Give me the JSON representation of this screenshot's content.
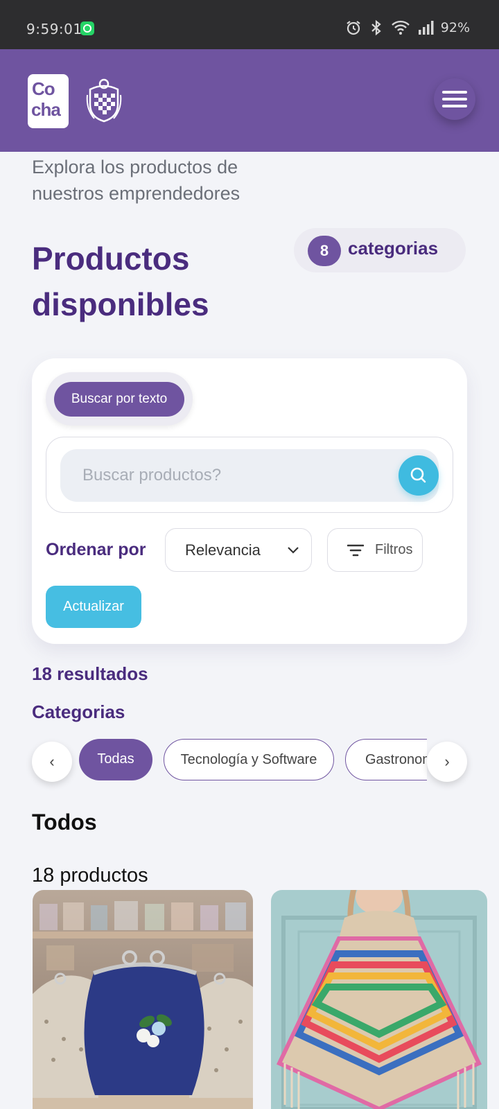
{
  "status_bar": {
    "time": "9:59:01",
    "battery": "92%"
  },
  "header": {
    "logo_line1": "Co",
    "logo_line2": "cha",
    "icons": [
      "whatsapp-icon",
      "alarm-icon",
      "bluetooth-icon",
      "wifi-icon",
      "signal-icon",
      "menu-icon"
    ]
  },
  "intro": "Explora los productos de nuestros emprendedores",
  "title": "Productos disponibles",
  "categories_badge": {
    "count": "8",
    "label": "categorias"
  },
  "search": {
    "tab_label": "Buscar por texto",
    "placeholder": "Buscar productos?"
  },
  "sort": {
    "label": "Ordenar por",
    "selected": "Relevancia",
    "filters_label": "Filtros",
    "update_label": "Actualizar"
  },
  "results_text": "18 resultados",
  "categories_heading": "Categorias",
  "category_chips": [
    "Todas",
    "Tecnología y Software",
    "Gastronomía"
  ],
  "chip_prev": "‹",
  "chip_next": "›",
  "section_title": "Todos",
  "products_count": "18 productos",
  "colors": {
    "brand_purple": "#6f54a0",
    "title_purple": "#4a2c7e",
    "accent_cyan": "#46bee2"
  }
}
